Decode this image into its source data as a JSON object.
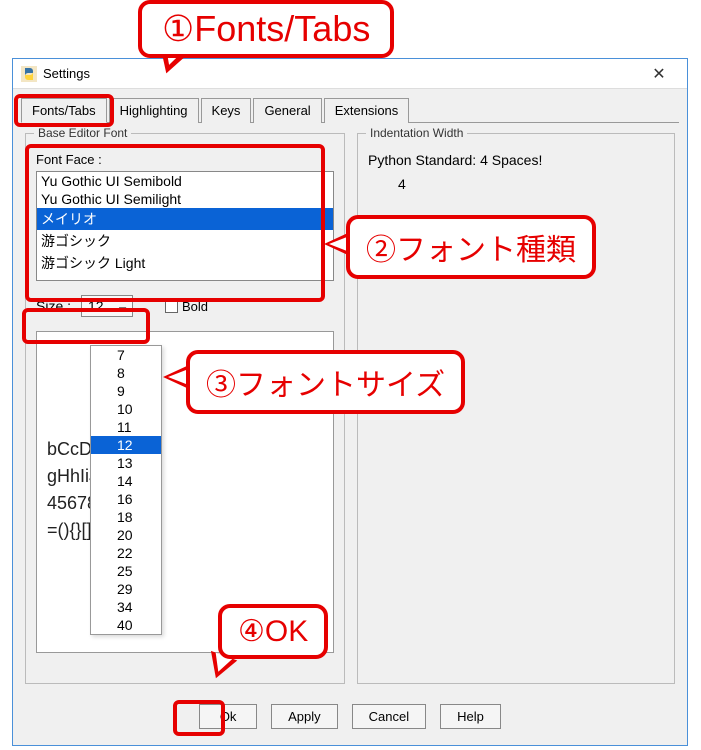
{
  "window": {
    "title": "Settings"
  },
  "tabs": [
    "Fonts/Tabs",
    "Highlighting",
    "Keys",
    "General",
    "Extensions"
  ],
  "active_tab": 0,
  "left_group": {
    "title": "Base Editor Font",
    "font_face_label": "Font Face :",
    "font_list": [
      "Yu Gothic UI Semibold",
      "Yu Gothic UI Semilight",
      "メイリオ",
      "游ゴシック",
      "游ゴシック Light"
    ],
    "font_selected_index": 2,
    "size_label": "Size :",
    "size_value": "12",
    "bold_label": "Bold",
    "bold_checked": false,
    "preview_lines": [
      "bCcDdEe",
      "gHhIiJjK",
      "4567890",
      "=(){}[]"
    ]
  },
  "right_group": {
    "title": "Indentation Width",
    "standard_text": "Python Standard: 4 Spaces!",
    "value": "4"
  },
  "size_options": [
    "7",
    "8",
    "9",
    "10",
    "11",
    "12",
    "13",
    "14",
    "16",
    "18",
    "20",
    "22",
    "25",
    "29",
    "34",
    "40"
  ],
  "size_selected_index": 5,
  "buttons": {
    "ok": "Ok",
    "apply": "Apply",
    "cancel": "Cancel",
    "help": "Help"
  },
  "annotations": {
    "a1": "①Fonts/Tabs",
    "a2": "②フォント種類",
    "a3": "③フォントサイズ",
    "a4": "④OK"
  }
}
